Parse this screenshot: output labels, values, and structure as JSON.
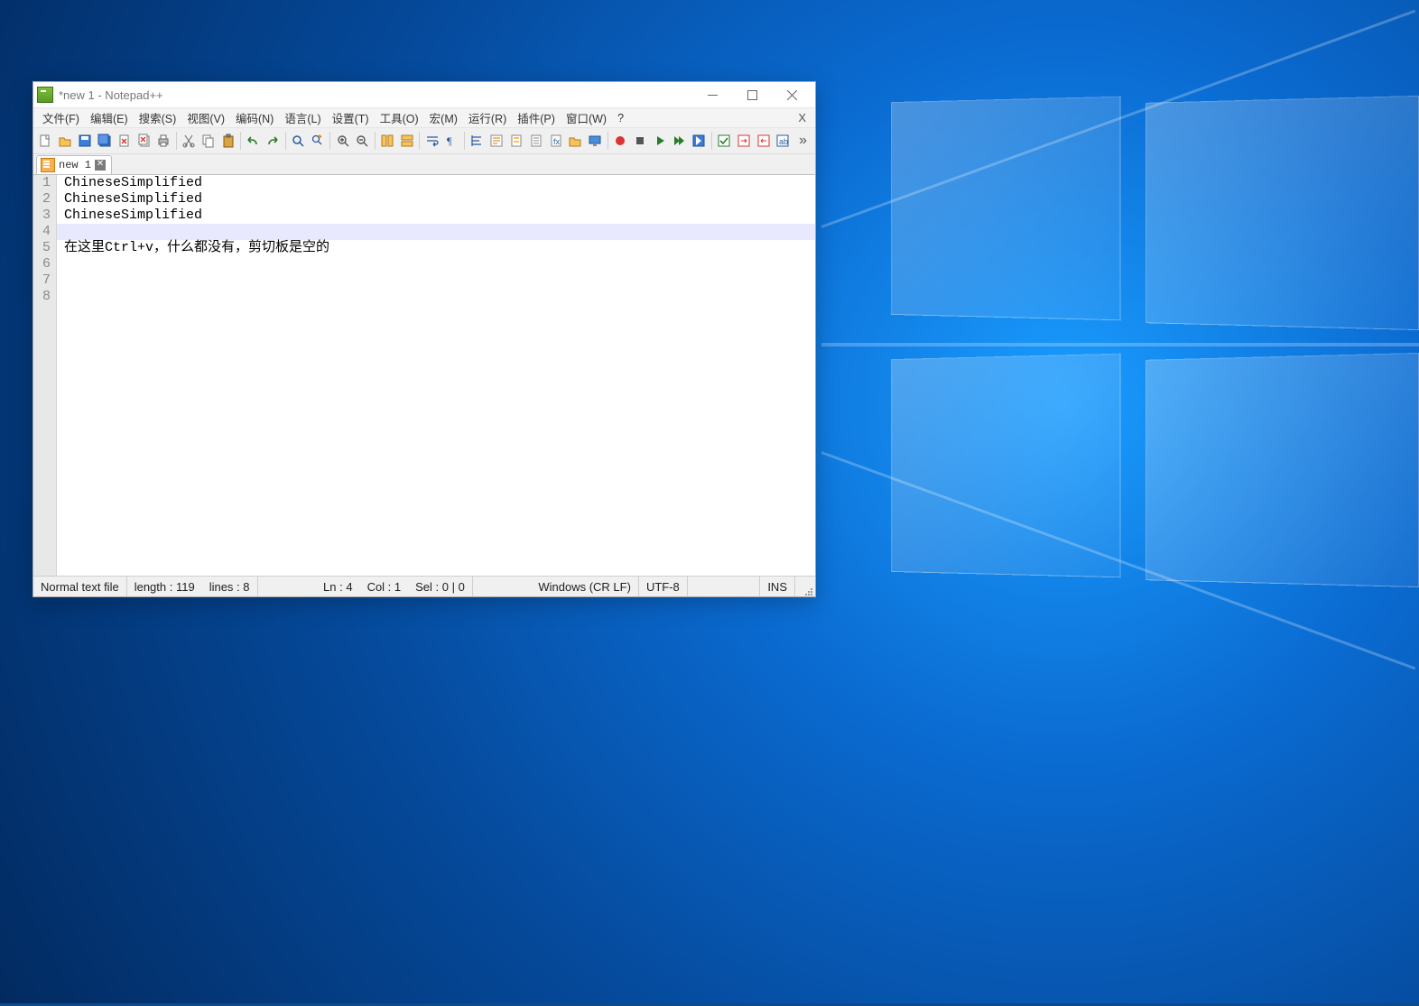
{
  "window": {
    "title": "*new 1 - Notepad++"
  },
  "menu": {
    "items": [
      "文件(F)",
      "编辑(E)",
      "搜索(S)",
      "视图(V)",
      "编码(N)",
      "语言(L)",
      "设置(T)",
      "工具(O)",
      "宏(M)",
      "运行(R)",
      "插件(P)",
      "窗口(W)",
      "?"
    ],
    "close_x": "X"
  },
  "toolbar": {
    "more": "»",
    "buttons": [
      "new-file-icon",
      "open-file-icon",
      "save-icon",
      "save-all-icon",
      "close-file-icon",
      "close-all-icon",
      "print-icon",
      "__sep",
      "cut-icon",
      "copy-icon",
      "paste-icon",
      "__sep",
      "undo-icon",
      "redo-icon",
      "__sep",
      "find-icon",
      "replace-icon",
      "__sep",
      "zoom-in-icon",
      "zoom-out-icon",
      "__sep",
      "sync-v-icon",
      "sync-h-icon",
      "__sep",
      "wordwrap-icon",
      "show-all-icon",
      "__sep",
      "indent-guide-icon",
      "udl-icon",
      "doc-map-icon",
      "doc-list-icon",
      "func-list-icon",
      "folder-icon",
      "monitor-icon",
      "__sep",
      "record-icon",
      "stop-icon",
      "play-icon",
      "play-multi-icon",
      "save-macro-icon",
      "__sep",
      "spell-on-icon",
      "spell-next-icon",
      "spell-prev-icon",
      "spell-lang-icon"
    ]
  },
  "tabs": {
    "items": [
      {
        "label": "new 1"
      }
    ]
  },
  "editor": {
    "lines": [
      "ChineseSimplified",
      "ChineseSimplified",
      "ChineseSimplified",
      "",
      "在这里Ctrl+v，什么都没有，剪切板是空的",
      "",
      "",
      ""
    ],
    "current_line_index": 3
  },
  "status": {
    "filetype": "Normal text file",
    "length": "length : 119",
    "lines": "lines : 8",
    "ln": "Ln : 4",
    "col": "Col : 1",
    "sel": "Sel : 0 | 0",
    "eol": "Windows (CR LF)",
    "encoding": "UTF-8",
    "mode": "INS"
  }
}
